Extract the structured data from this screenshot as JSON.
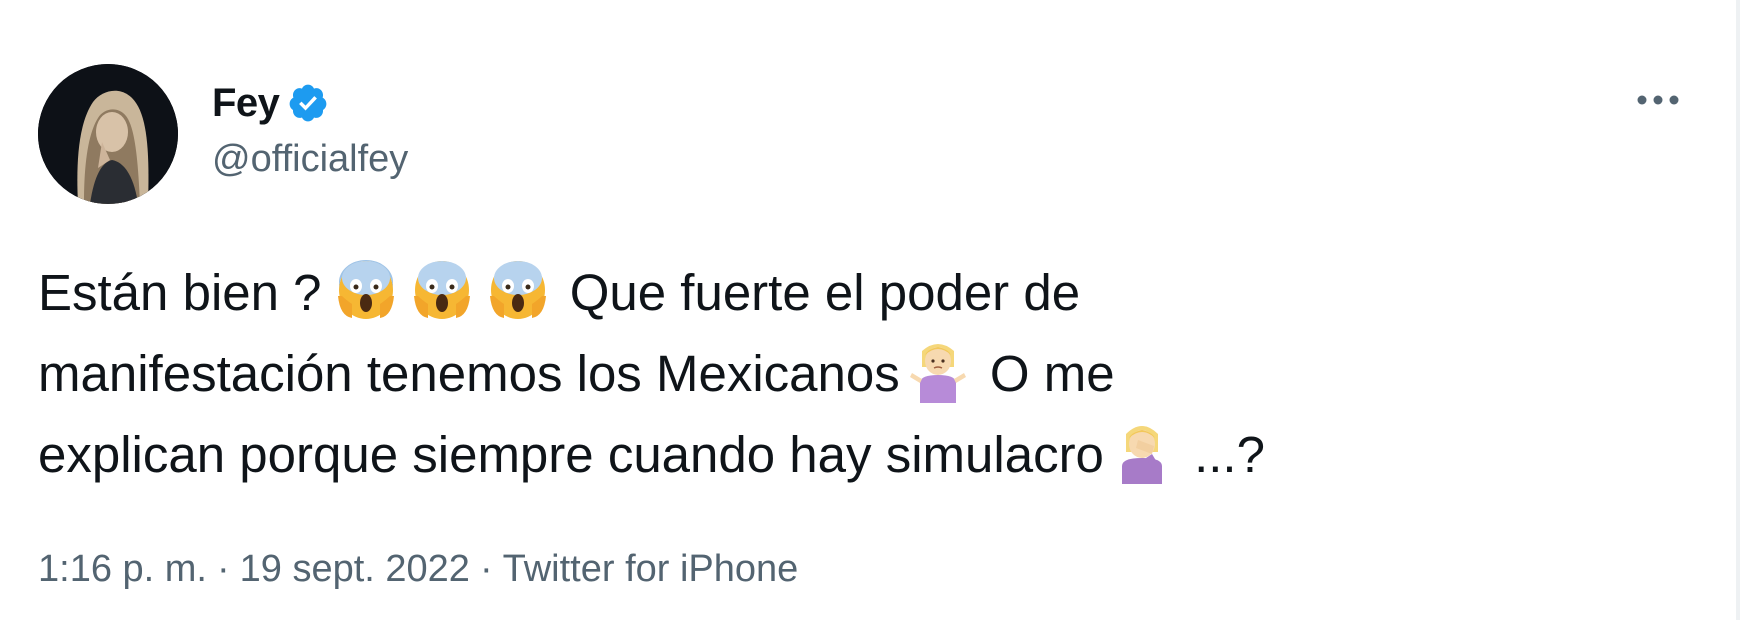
{
  "author": {
    "display_name": "Fey",
    "handle": "@officialfey",
    "verified": true,
    "avatar_icon": "profile-photo"
  },
  "menu": {
    "icon": "more-horizontal-icon"
  },
  "tweet": {
    "line1_a": "Están bien ?",
    "emoji_scream": "face-screaming-in-fear",
    "line1_b": "Que fuerte el poder de",
    "line2_a": "manifestación tenemos los Mexicanos",
    "emoji_shrug": "person-shrugging",
    "line2_b": "O me",
    "line3_a": "explican porque siempre cuando hay simulacro",
    "emoji_facepalm": "person-facepalming",
    "line3_b": "...?"
  },
  "meta": {
    "time": "1:16 p. m.",
    "date": "19 sept. 2022",
    "source": "Twitter for iPhone",
    "separator": "·"
  },
  "colors": {
    "text": "#0f1419",
    "secondary": "#536471",
    "verified_blue": "#1d9bf0"
  }
}
